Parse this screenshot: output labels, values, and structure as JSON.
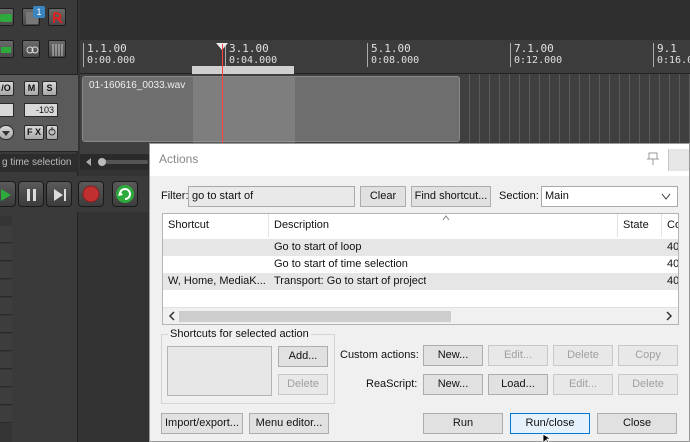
{
  "ruler": {
    "marks": [
      {
        "bar": "1.1.00",
        "time": "0:00.000"
      },
      {
        "bar": "3.1.00",
        "time": "0:04.000"
      },
      {
        "bar": "5.1.00",
        "time": "0:08.000"
      },
      {
        "bar": "7.1.00",
        "time": "0:12.000"
      },
      {
        "bar": "9.1",
        "time": "0:16.0"
      }
    ]
  },
  "track": {
    "io_label": "/O",
    "mute_label": "M",
    "solo_label": "S",
    "volume": "-103",
    "fx_label": "F X",
    "item_name": "01-160616_0033.wav",
    "status": "g time selection",
    "badge": "1"
  },
  "dialog": {
    "title": "Actions",
    "filter_label": "Filter:",
    "filter_value": "go to start of",
    "clear_label": "Clear",
    "find_shortcut_label": "Find shortcut...",
    "section_label": "Section:",
    "section_value": "Main",
    "columns": [
      "Shortcut",
      "Description",
      "State",
      "Co"
    ],
    "rows": [
      {
        "shortcut": "",
        "description": "Go to start of loop",
        "state": "",
        "cmd": "40"
      },
      {
        "shortcut": "",
        "description": "Go to start of time selection",
        "state": "",
        "cmd": "40"
      },
      {
        "shortcut": "W, Home, MediaK...",
        "description": "Transport: Go to start of project",
        "state": "",
        "cmd": "40"
      }
    ],
    "shortcuts_group_label": "Shortcuts for selected action",
    "add_label": "Add...",
    "delete_label": "Delete",
    "custom_actions_label": "Custom actions:",
    "reascript_label": "ReaScript:",
    "custom_new_label": "New...",
    "custom_edit_label": "Edit...",
    "custom_delete_label": "Delete",
    "custom_copy_label": "Copy",
    "rs_new_label": "New...",
    "rs_load_label": "Load...",
    "rs_edit_label": "Edit...",
    "rs_delete_label": "Delete",
    "import_export_label": "Import/export...",
    "menu_editor_label": "Menu editor...",
    "run_label": "Run",
    "run_close_label": "Run/close",
    "close_label": "Close"
  },
  "colors": {
    "record": "#c03030",
    "play": "#2eaa3c",
    "cursor": "#ff4040",
    "accent": "#0078d7"
  }
}
